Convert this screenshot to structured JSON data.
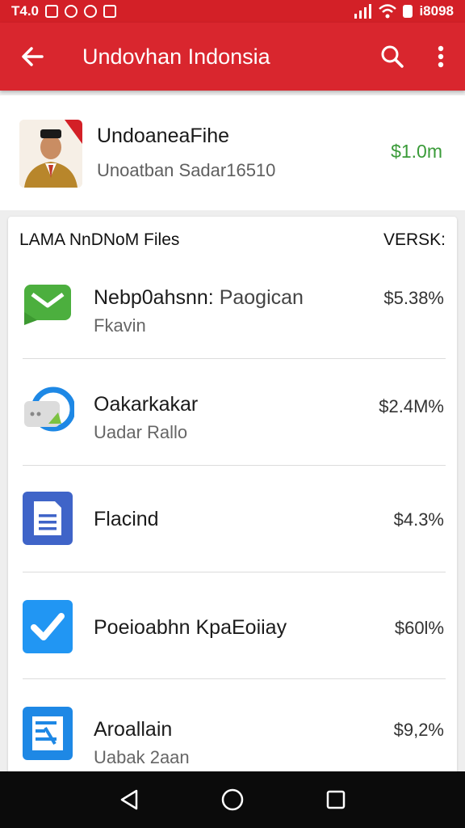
{
  "status_bar": {
    "left_text": "T4.0",
    "right_text": "i8098"
  },
  "app_bar": {
    "title": "Undovhan Indonsia",
    "back_icon": "arrow-back-icon",
    "search_icon": "search-icon",
    "more_icon": "more-vert-icon",
    "color": "#d9262e"
  },
  "header": {
    "title": "UndoaneaFihe",
    "subtitle": "Unoatban Sadar16510",
    "price": "$1.0m",
    "price_color": "#3a9b39"
  },
  "files": {
    "header_left": "LAMA NnDNoM Files",
    "header_right": "VERSK:",
    "items": [
      {
        "name": "Nebp0ahsnn:",
        "name_extra": "Paogican",
        "subtitle": "Fkavin",
        "value": "$5.38%",
        "icon": "message-icon"
      },
      {
        "name": "Oakarkakar",
        "name_extra": "",
        "subtitle": "Uadar Rallo",
        "value": "$2.4M%",
        "icon": "sync-icon"
      },
      {
        "name": "Flacind",
        "name_extra": "",
        "subtitle": "",
        "value": "$4.3%",
        "icon": "document-icon"
      },
      {
        "name": "Poeioabhn KpaEoiiay",
        "name_extra": "",
        "subtitle": "",
        "value": "$60l%",
        "icon": "check-icon"
      },
      {
        "name": "Aroallain",
        "name_extra": "",
        "subtitle": "Uabak 2aan",
        "value": "$9,2%",
        "icon": "task-list-icon"
      }
    ]
  },
  "nav_bar": {
    "back_icon": "nav-back-icon",
    "home_icon": "nav-home-icon",
    "recents_icon": "nav-recents-icon"
  }
}
